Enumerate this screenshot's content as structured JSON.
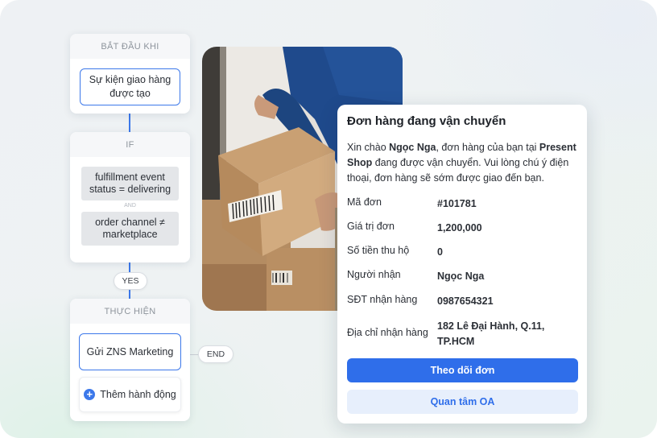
{
  "workflow": {
    "trigger": {
      "header": "BẮT ĐẦU KHI",
      "event_line1": "Sự kiện giao hàng",
      "event_line2": "được tạo"
    },
    "condition": {
      "header": "IF",
      "cond1_line1": "fulfillment event",
      "cond1_line2": "status = delivering",
      "and_label": "AND",
      "cond2_line1": "order channel ≠",
      "cond2_line2": "marketplace"
    },
    "yes_label": "YES",
    "action": {
      "header": "THỰC HIỆN",
      "action_label": "Gửi ZNS Marketing",
      "add_label": "Thêm hành động"
    },
    "end_label": "END"
  },
  "order_card": {
    "title": "Đơn hàng đang vận chuyển",
    "msg_greeting": "Xin chào ",
    "msg_name": "Ngọc Nga",
    "msg_mid": ", đơn hàng của bạn tại ",
    "msg_shop": "Present Shop",
    "msg_rest": " đang được vận chuyển. Vui lòng chú ý điện thoại, đơn hàng sẽ sớm được giao đến bạn.",
    "rows": [
      {
        "label": "Mã đơn",
        "value": "#101781"
      },
      {
        "label": "Giá trị đơn",
        "value": "1,200,000"
      },
      {
        "label": "Số tiền thu hộ",
        "value": "0"
      },
      {
        "label": "Người nhận",
        "value": "Ngọc Nga"
      },
      {
        "label": "SĐT nhận hàng",
        "value": "0987654321"
      },
      {
        "label": "Địa chỉ nhận hàng",
        "value": "182 Lê Đại Hành, Q.11, TP.HCM"
      }
    ],
    "primary_button": "Theo dõi đơn",
    "secondary_button": "Quan tâm OA"
  },
  "colors": {
    "accent": "#2f6eea",
    "connector": "#3c78ea",
    "card_bg": "#ffffff"
  },
  "icons": {
    "add": "plus-circle-icon"
  }
}
